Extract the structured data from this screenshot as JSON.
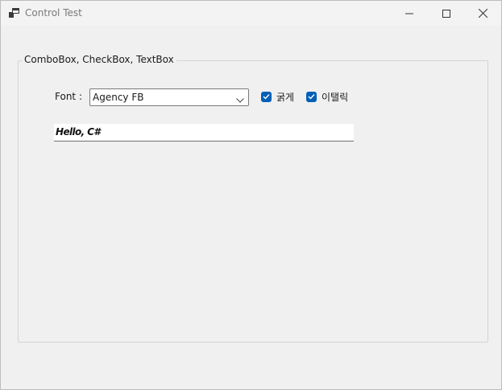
{
  "window": {
    "title": "Control Test",
    "icons": {
      "app": "app-icon",
      "minimize": "minimize-icon",
      "maximize": "maximize-icon",
      "close": "close-icon"
    }
  },
  "group": {
    "label": "ComboBox, CheckBox, TextBox"
  },
  "font_selector": {
    "label": "Font :",
    "selected": "Agency FB"
  },
  "checkboxes": [
    {
      "label": "굵게",
      "checked": true
    },
    {
      "label": "이탤릭",
      "checked": true
    }
  ],
  "textbox": {
    "value": "Hello, C#"
  },
  "colors": {
    "accent": "#005fb8",
    "background": "#f0f0f0"
  }
}
